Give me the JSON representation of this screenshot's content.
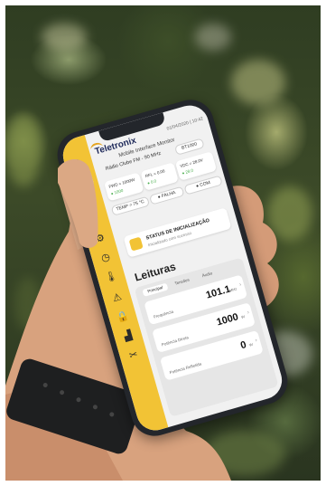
{
  "app": {
    "brand": "Teletronix",
    "datetime": "01/04/2020 | 10:42",
    "subtitle": "Mobile Interface Monitor",
    "radio_name": "Rádio Clube FM - 90 MHz",
    "radio_model": "BT1000"
  },
  "metrics": {
    "fwd_label": "FWD = 1000W",
    "fwd_sub": "● 1000",
    "rfl_label": "RFL = 0.00",
    "rfl_sub": "● 0.0",
    "vdc_label": "VDC = 28.0V",
    "vdc_sub": "● 28.0",
    "temp_label": "TEMP = 75 °C",
    "falha_label": "● FALHA",
    "com_label": "● COM"
  },
  "status": {
    "title": "STATUS DE INICIALIZAÇÃO",
    "subtitle": "Inicializado com sucesso"
  },
  "readings": {
    "title": "Leituras",
    "tabs": [
      "Principal",
      "Tensões",
      "Áudio"
    ],
    "rows": [
      {
        "label": "Frequência",
        "value": "101.1",
        "unit": "MHz"
      },
      {
        "label": "Potência Direta",
        "value": "1000",
        "unit": "W"
      },
      {
        "label": "Potência Refletida",
        "value": "0",
        "unit": "W"
      }
    ]
  },
  "sidebar": {
    "icons": [
      "home-icon",
      "menu-icon",
      "info-icon",
      "compass-icon",
      "settings-icon",
      "clock-icon",
      "thermometer-icon",
      "warning-icon",
      "lock-icon",
      "signal-icon",
      "tools-icon"
    ]
  },
  "colors": {
    "accent": "#f2c335",
    "brand_text": "#1f2a5a"
  }
}
